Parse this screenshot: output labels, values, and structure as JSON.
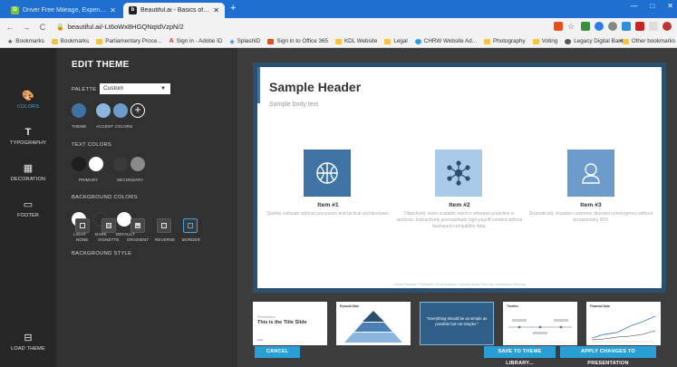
{
  "browser": {
    "tabs": [
      {
        "label": "Driver Free Mileage, Expense & ...",
        "favicon": "D",
        "active": false
      },
      {
        "label": "Beautiful.ai - Basics of EP",
        "favicon": "b",
        "active": true
      }
    ],
    "new_tab": "+",
    "window_controls": [
      "—",
      "□",
      "✕"
    ],
    "nav": {
      "back": "←",
      "forward": "→",
      "reload": "C"
    },
    "url": "beautiful.ai/-Lt6oWx8HGQNqIdVzpN/2",
    "bookmarks": [
      {
        "label": "Bookmarks",
        "kind": "star"
      },
      {
        "label": "Bookmarks",
        "kind": "folder"
      },
      {
        "label": "Parliamentary Proce...",
        "kind": "folder"
      },
      {
        "label": "Sign in - Adobe ID",
        "kind": "adobe"
      },
      {
        "label": "SplashID",
        "kind": "splash"
      },
      {
        "label": "Sign in to Office 365",
        "kind": "office"
      },
      {
        "label": "KDL Website",
        "kind": "folder"
      },
      {
        "label": "Legal",
        "kind": "folder"
      },
      {
        "label": "CHRW Website Ad...",
        "kind": "chrw"
      },
      {
        "label": "Photography",
        "kind": "folder"
      },
      {
        "label": "Voting",
        "kind": "folder"
      },
      {
        "label": "Legacy Digital Bank...",
        "kind": "legacy"
      }
    ],
    "bookmarks_more": "»",
    "other_bookmarks": "Other bookmarks"
  },
  "rail": {
    "items": [
      {
        "label": "COLORS",
        "icon": "palette-icon",
        "glyph": "🎨",
        "active": true
      },
      {
        "label": "TYPOGRAPHY",
        "icon": "typography-icon",
        "glyph": "T",
        "active": false
      },
      {
        "label": "DECORATION",
        "icon": "decoration-icon",
        "glyph": "▦",
        "active": false
      },
      {
        "label": "FOOTER",
        "icon": "footer-icon",
        "glyph": "▭",
        "active": false
      }
    ],
    "load_theme": {
      "label": "LOAD THEME",
      "glyph": "⊟"
    }
  },
  "panel": {
    "title": "EDIT THEME",
    "palette_label": "PALETTE",
    "palette_value": "Custom",
    "theme_label": "THEME",
    "accent_label": "ACCENT COLORS",
    "text_colors_label": "TEXT COLORS",
    "primary_label": "PRIMARY",
    "secondary_label": "SECONDARY",
    "bg_colors_label": "BACKGROUND COLORS",
    "light_label": "LIGHT",
    "dark_label": "DARK",
    "default_label": "DEFAULT",
    "bg_style_label": "BACKGROUND STYLE",
    "bg_styles": [
      "NONE",
      "VIGNETTE",
      "GRADIENT",
      "REVERSE",
      "BORDER"
    ],
    "colors": {
      "theme": "#3f73a3",
      "accent1": "#8ab6e0",
      "accent2": "#6d9ccc",
      "primary_text_dark": "#1e1e1e",
      "primary_text_light": "#ffffff",
      "secondary_text1": "#3a3a3a",
      "secondary_text2": "#8a8a8a",
      "bg_light": "#ffffff",
      "bg_dark": "#2e2e2e",
      "bg_default": "#ffffff",
      "accent_ui": "#4aa3df"
    }
  },
  "slide": {
    "header": "Sample Header",
    "body": "Sample body text",
    "items": [
      {
        "title": "Item #1",
        "desc": "Quickly cultivate optimal processes and tactical architectures.",
        "icon": "basketball-icon"
      },
      {
        "title": "Item #2",
        "desc": "Objectively seize scalable metrics whereas proactive e-services. Interactively procrastinate high-payoff content without backward-compatible data.",
        "icon": "network-icon"
      },
      {
        "title": "Item #3",
        "desc": "Dramatically visualize customer directed convergence without revolutionary ROI.",
        "icon": "user-icon"
      }
    ],
    "footer": "Global Planning / Profitable / Good Analysis / Special Media Planning / Distribution Planning"
  },
  "thumbnails": [
    {
      "title": "This is the Title Slide",
      "kicker": "Presentation",
      "tag": "slide"
    },
    {
      "title": "Pyramid Slide",
      "kicker": "",
      "tag": ""
    },
    {
      "title": "“Everything should be as simple as possible but not simpler.”",
      "kicker": "",
      "tag": ""
    },
    {
      "title": "Timeline",
      "kicker": "",
      "tag": ""
    },
    {
      "title": "Financial Data",
      "kicker": "",
      "tag": ""
    }
  ],
  "buttons": {
    "cancel": "CANCEL",
    "save": "SAVE TO THEME LIBRARY...",
    "apply": "APPLY CHANGES TO PRESENTATION"
  }
}
